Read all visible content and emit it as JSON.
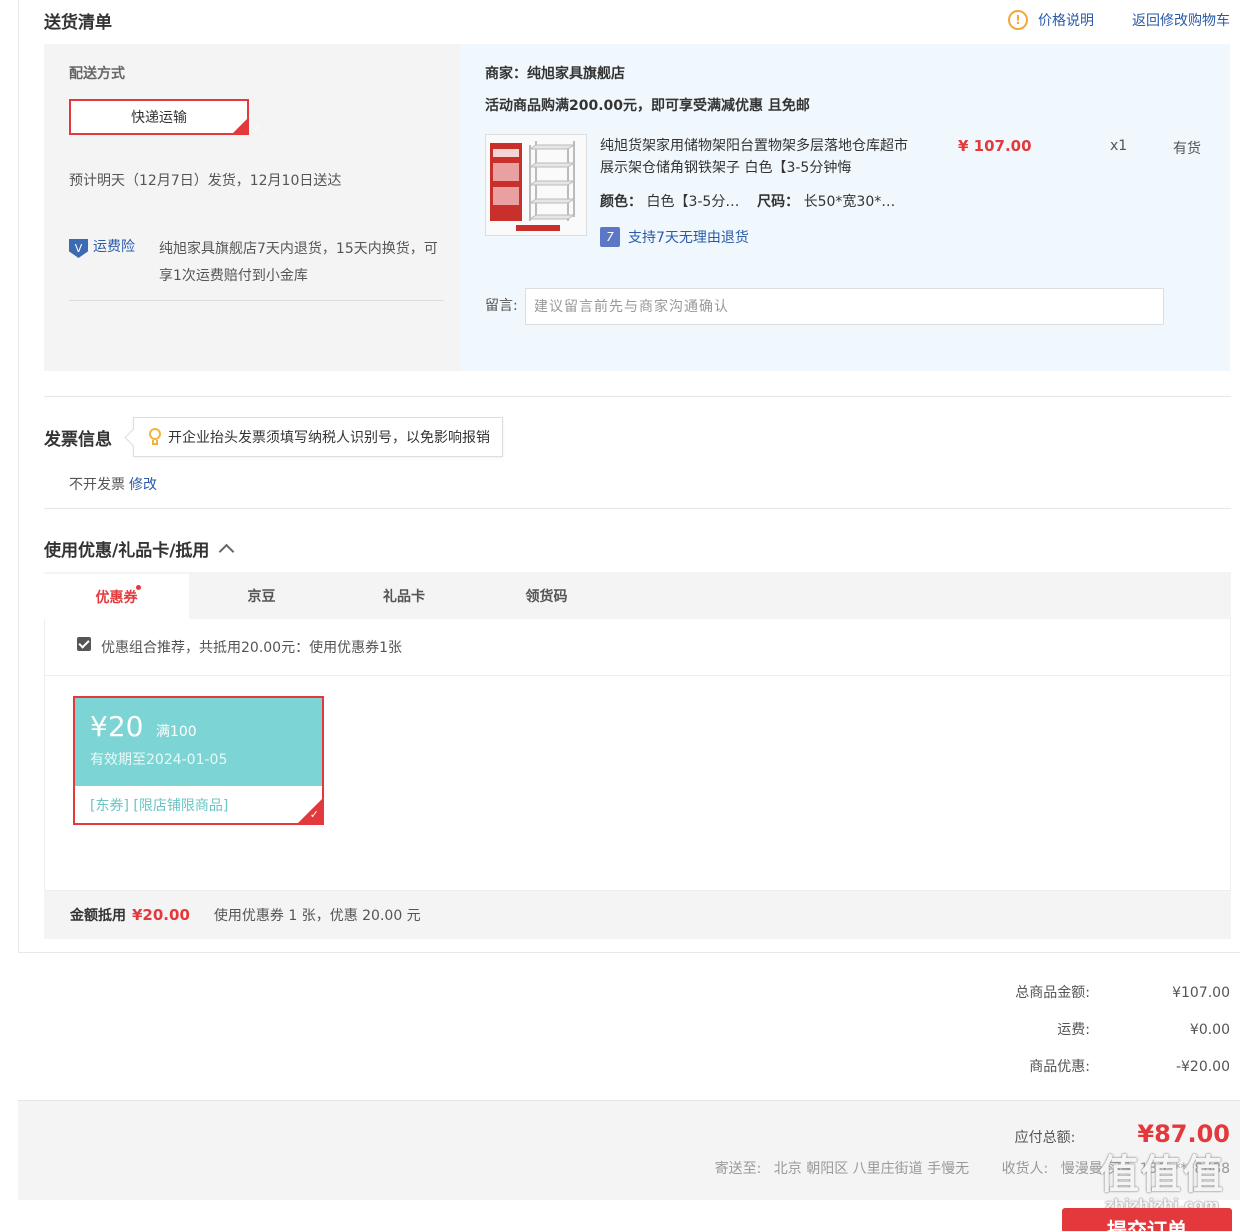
{
  "delivery": {
    "title": "送货清单",
    "price_note": "价格说明",
    "back_to_cart": "返回修改购物车",
    "method_label": "配送方式",
    "method_selected": "快递运输",
    "eta": "预计明天（12月7日）发货，12月10日送达",
    "insurance_label": "运费险",
    "insurance_text": "纯旭家具旗舰店7天内退货，15天内换货，可享1次运费赔付到小金库",
    "merchant": "商家：纯旭家具旗舰店",
    "promo": "活动商品购满200.00元，即可享受满减优惠 且免邮",
    "product": {
      "name": "纯旭货架家用储物架阳台置物架多层落地仓库超市展示架仓储角钢铁架子 白色【3-5分钟悔",
      "color_label": "颜色：",
      "color_value": "白色【3-5分…",
      "size_label": "尺码：",
      "size_value": "长50*宽30*…",
      "return_policy": "支持7天无理由退货",
      "price": "¥ 107.00",
      "qty": "x1",
      "stock": "有货"
    },
    "message_label": "留言:",
    "message_placeholder": "建议留言前先与商家沟通确认"
  },
  "invoice": {
    "title": "发票信息",
    "tip": "开企业抬头发票须填写纳税人识别号，以免影响报销",
    "status": "不开发票",
    "edit": "修改"
  },
  "coupons": {
    "title": "使用优惠/礼品卡/抵用",
    "tabs": [
      {
        "label": "优惠券",
        "active": true
      },
      {
        "label": "京豆"
      },
      {
        "label": "礼品卡"
      },
      {
        "label": "领货码"
      }
    ],
    "combo_text": "优惠组合推荐，共抵用20.00元：使用优惠券1张",
    "combo_checked": true,
    "card": {
      "currency": "¥",
      "amount": "20",
      "condition": "满100",
      "expiry": "有效期至2024-01-05",
      "tags": "[东券] [限店铺限商品]"
    },
    "summary_label": "金额抵用",
    "summary_amount": "¥20.00",
    "summary_text": "使用优惠券 1 张，优惠 20.00 元"
  },
  "totals": {
    "rows": [
      {
        "label": "总商品金额:",
        "value": "¥107.00"
      },
      {
        "label": "运费:",
        "value": "¥0.00"
      },
      {
        "label": "商品优惠:",
        "value": "-¥20.00"
      }
    ],
    "due_label": "应付总额:",
    "due_value": "¥87.00",
    "ship_to_label": "寄送至:",
    "ship_to_address": "北京 朝阳区 八里庄街道 手慢无",
    "receiver_label": "收货人:",
    "receiver_value": "慢漫曼 买手 130****8888"
  },
  "submit_label": "提交订单",
  "watermark": {
    "brand": "值值值",
    "url": "zhizhizhi.com"
  },
  "colors": {
    "accent": "#e4393c",
    "link": "#2b5aa8",
    "coupon": "#7dd4d4",
    "merchant_bg": "#f0f8fd"
  }
}
